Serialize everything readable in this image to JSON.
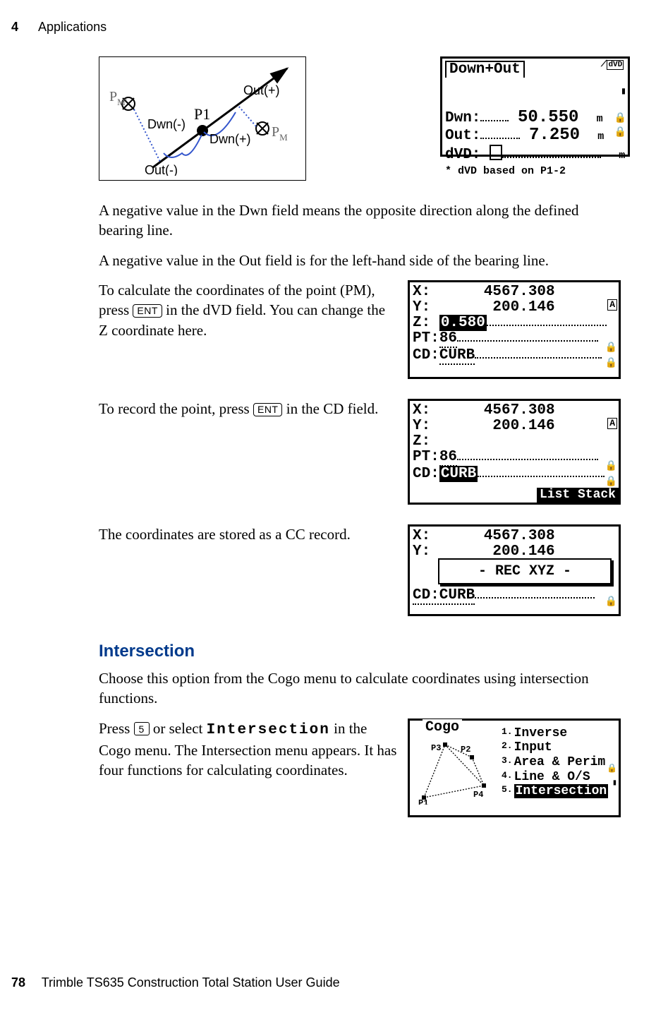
{
  "header": {
    "chapter_number": "4",
    "chapter_title": "Applications"
  },
  "diagram": {
    "labels": {
      "pm_left": "P",
      "pm_left_sub": "M'",
      "p1": "P1",
      "pm_right": "P",
      "pm_right_sub": "M",
      "out_plus": "Out(+)",
      "dwn_minus": "Dwn(-)",
      "dwn_plus": "Dwn(+)",
      "out_minus": "Out(-)"
    }
  },
  "lcd1": {
    "title": "Down+Out",
    "rows": [
      {
        "label": "Dwn:",
        "value": "50.550",
        "unit": "m"
      },
      {
        "label": "Out:",
        "value": "7.250",
        "unit": "m"
      },
      {
        "label": "dVD:",
        "value": "",
        "unit": "m"
      }
    ],
    "note": "* dVD based on P1-2",
    "icon": "dVD"
  },
  "paragraphs": {
    "p1": "A negative value in the Dwn field means the opposite direction along the defined bearing line.",
    "p2": "A negative value in the Out field is for the left-hand side of the bearing line.",
    "p3a": "To calculate the coordinates of the point (PM), press ",
    "p3b": " in the dVD field. You can change the Z coordinate here.",
    "p4a": "To record the point, press ",
    "p4b": " in the CD field.",
    "p5": "The coordinates are stored as a CC record.",
    "intersection1": "Choose this option from the Cogo menu to calculate coordinates using intersection functions.",
    "intersection2a": "Press ",
    "intersection2b": " or select ",
    "intersection2c": " in the Cogo menu. The Intersection menu appears. It has four functions for calculating coordinates."
  },
  "keys": {
    "ent": "ENT",
    "five": "5"
  },
  "lcd2": {
    "x": "X:      4567.308",
    "y": "Y:       200.146",
    "z_label": "Z:",
    "z_val": "0.580",
    "pt_label": "PT:",
    "pt_val": "86",
    "cd_label": "CD:",
    "cd_val": "CURB",
    "badge": "A"
  },
  "lcd3": {
    "x": "X:      4567.308",
    "y": "Y:       200.146",
    "z": "Z:",
    "pt_label": "PT:",
    "pt_val": "86",
    "cd_label": "CD:",
    "cd_val": "CURB",
    "badge": "A",
    "bottom": "List Stack"
  },
  "lcd4": {
    "x": "X:      4567.308",
    "y": "Y:       200.146",
    "cd": "CD:CURB",
    "overlay": "- REC XYZ -"
  },
  "section": {
    "title": "Intersection",
    "monoword": "Intersection"
  },
  "cogo_menu": {
    "title": "Cogo",
    "items": [
      {
        "num": "1.",
        "label": "Inverse"
      },
      {
        "num": "2.",
        "label": "Input"
      },
      {
        "num": "3.",
        "label": "Area & Perim"
      },
      {
        "num": "4.",
        "label": "Line & O/S"
      },
      {
        "num": "5.",
        "label": "Intersection"
      }
    ],
    "pts": {
      "p1": "P1",
      "p2": "P2",
      "p3": "P3",
      "p4": "P4"
    }
  },
  "footer": {
    "page": "78",
    "book": "Trimble TS635 Construction Total Station User Guide"
  }
}
